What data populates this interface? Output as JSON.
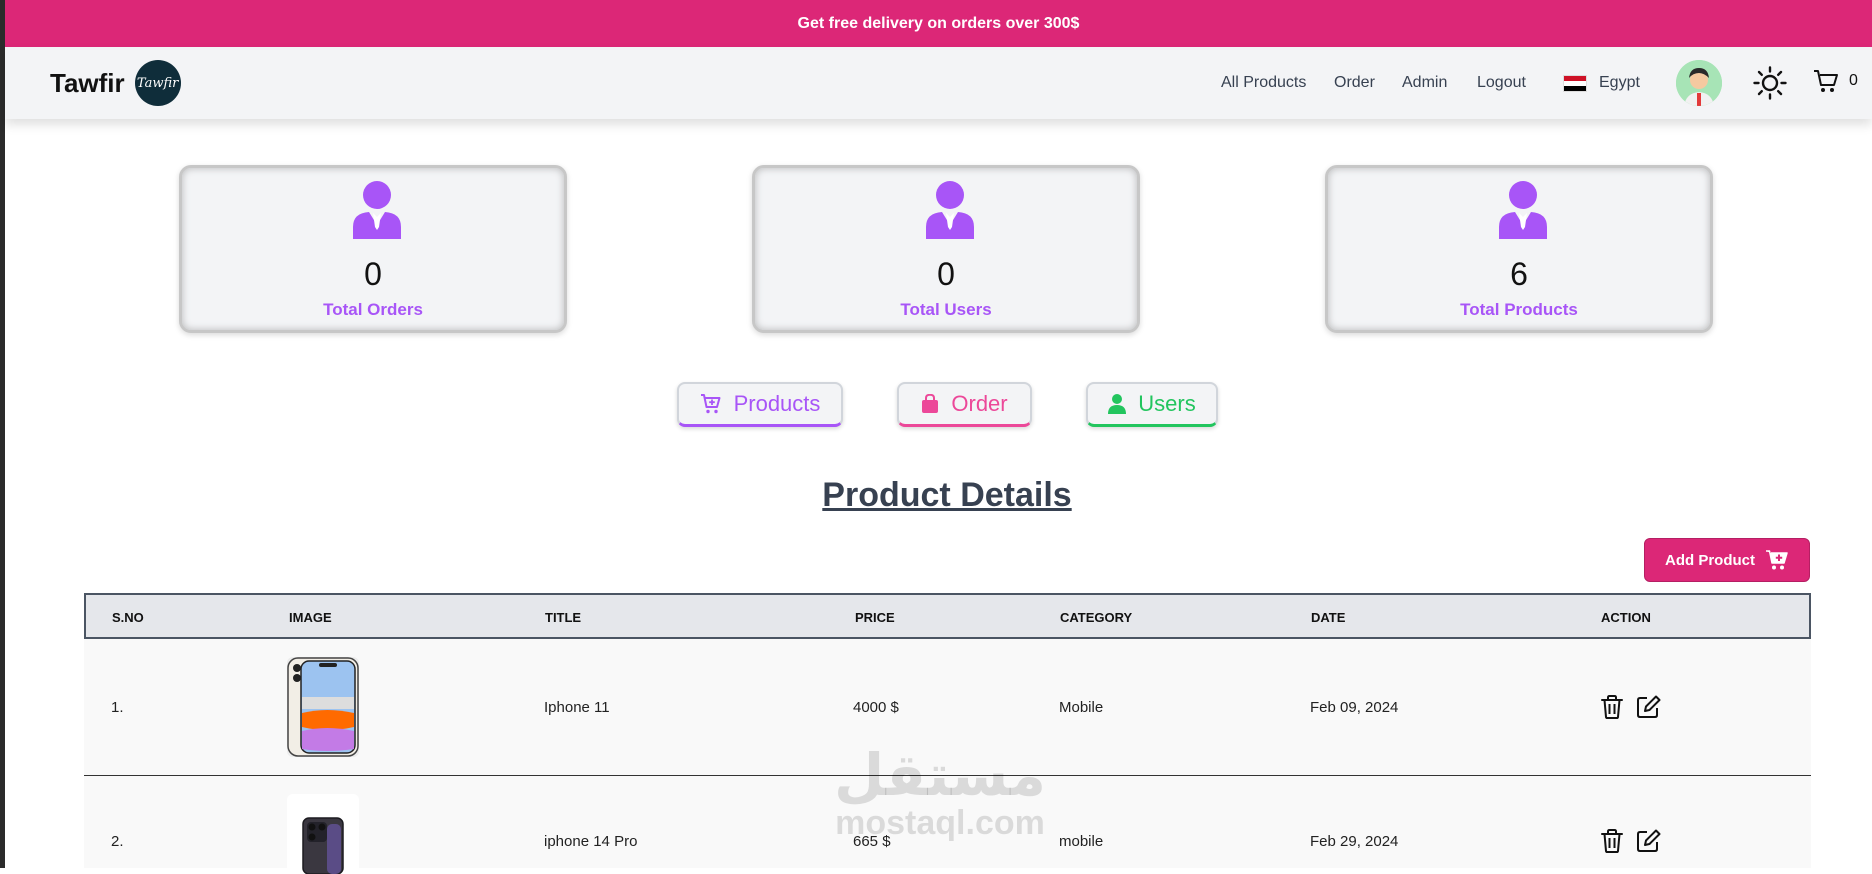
{
  "promo": {
    "text": "Get free delivery on orders over 300$"
  },
  "navbar": {
    "brand": "Tawfir",
    "logo_text": "Tawfir",
    "links": [
      "All Products",
      "Order",
      "Admin",
      "Logout"
    ],
    "country": "Egypt",
    "cart_count": "0"
  },
  "stats": [
    {
      "value": "0",
      "label": "Total Orders"
    },
    {
      "value": "0",
      "label": "Total Users"
    },
    {
      "value": "6",
      "label": "Total Products"
    }
  ],
  "tabs": [
    {
      "label": "Products",
      "color": "#a855f7",
      "icon": "cart-icon"
    },
    {
      "label": "Order",
      "color": "#ec4899",
      "icon": "shopping-bag-icon"
    },
    {
      "label": "Users",
      "color": "#22c55e",
      "icon": "user-icon"
    }
  ],
  "section": {
    "title": "Product Details"
  },
  "add_button": {
    "label": "Add Product"
  },
  "table": {
    "headers": [
      "S.NO",
      "IMAGE",
      "TITLE",
      "PRICE",
      "CATEGORY",
      "DATE",
      "ACTION"
    ],
    "rows": [
      {
        "sno": "1.",
        "image": "iphone-11-image",
        "title": "Iphone 11",
        "price": "4000 $",
        "category": "Mobile",
        "date": "Feb 09, 2024"
      },
      {
        "sno": "2.",
        "image": "iphone-14-pro-image",
        "title": "iphone 14 Pro",
        "price": "665 $",
        "category": "mobile",
        "date": "Feb 29, 2024"
      }
    ]
  },
  "watermark": {
    "arabic": "مستقل",
    "latin": "mostaql.com"
  },
  "colors": {
    "accent": "#dc2777",
    "purple": "#a855f7",
    "green": "#22c55e",
    "pink": "#ec4899"
  }
}
